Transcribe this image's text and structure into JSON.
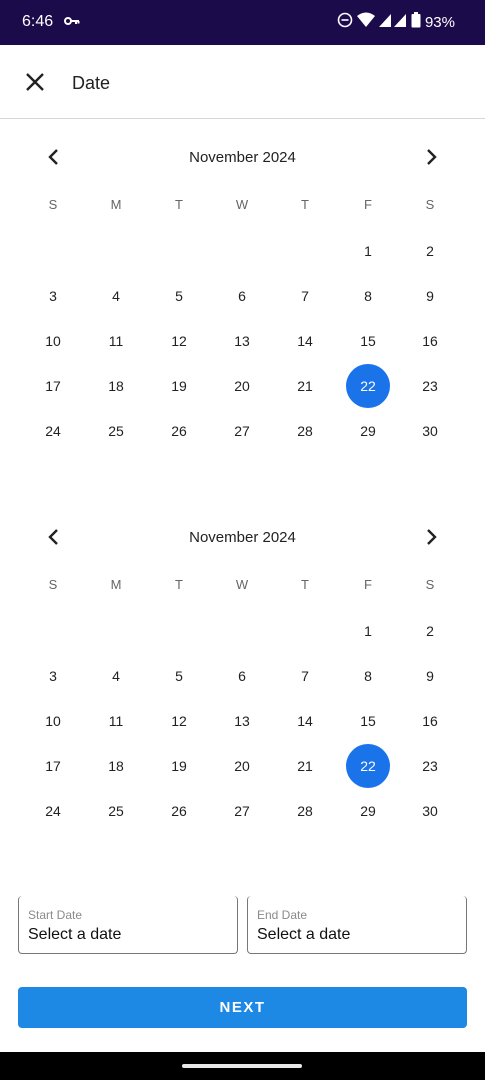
{
  "status": {
    "time": "6:46",
    "battery": "93%"
  },
  "header": {
    "title": "Date"
  },
  "calendars": [
    {
      "month": "November 2024",
      "selected_day": "22"
    },
    {
      "month": "November 2024",
      "selected_day": "22"
    }
  ],
  "weekdays": [
    "S",
    "M",
    "T",
    "W",
    "T",
    "F",
    "S"
  ],
  "weeks": [
    [
      "",
      "",
      "",
      "",
      "",
      "1",
      "2"
    ],
    [
      "3",
      "4",
      "5",
      "6",
      "7",
      "8",
      "9"
    ],
    [
      "10",
      "11",
      "12",
      "13",
      "14",
      "15",
      "16"
    ],
    [
      "17",
      "18",
      "19",
      "20",
      "21",
      "22",
      "23"
    ],
    [
      "24",
      "25",
      "26",
      "27",
      "28",
      "29",
      "30"
    ]
  ],
  "fields": {
    "start": {
      "label": "Start Date",
      "value": "Select a date"
    },
    "end": {
      "label": "End Date",
      "value": "Select a date"
    }
  },
  "actions": {
    "next_label": "NEXT"
  },
  "colors": {
    "accent": "#1a73e8",
    "button": "#1e88e5",
    "statusbar": "#1c0b4a"
  },
  "icons": [
    "key-icon",
    "dnd-icon",
    "wifi-icon",
    "signal-icon",
    "battery-icon",
    "close-icon",
    "chevron-left-icon",
    "chevron-right-icon"
  ]
}
